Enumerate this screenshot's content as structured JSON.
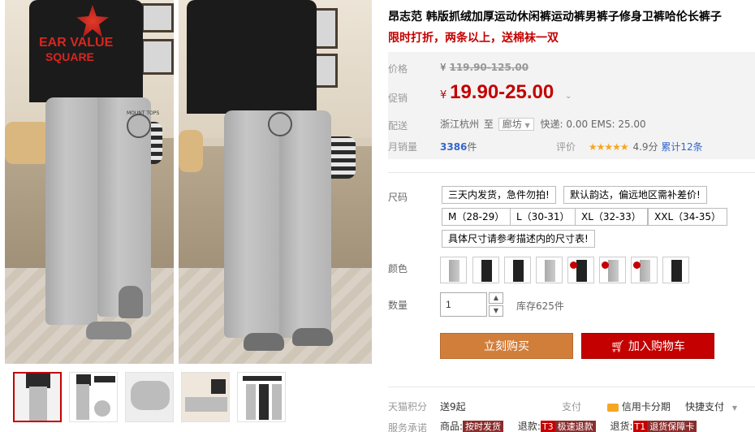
{
  "product": {
    "title": "昂志范 韩版抓绒加厚运动休闲裤运动裤男裤子修身卫裤哈伦长裤子",
    "promo": "限时打折，两条以上，送棉袜一双"
  },
  "main_photo": {
    "shirt_print_line1": "EAR VALUE",
    "shirt_print_line2": "SQUARE",
    "badge_text": "MOUNT TOPS"
  },
  "pricing": {
    "original_label": "价格",
    "currency": "¥",
    "original_price": "119.90-125.00",
    "promo_label": "促销",
    "promo_price": "19.90-25.00",
    "delivery_label": "配送",
    "origin": "浙江杭州",
    "to": "至",
    "destination": "廊坊",
    "shipping": "快递: 0.00 EMS: 25.00",
    "monthly_label": "月销量",
    "monthly_sales": "3386",
    "monthly_unit": "件",
    "rating_label": "评价",
    "stars": "★★★★★",
    "score": "4.9分",
    "reviews": "累计12条"
  },
  "sizes": {
    "label": "尺码",
    "notes": [
      "三天内发货，急件勿拍!",
      "默认韵达，偏远地区需补差价!"
    ],
    "options": [
      "M（28-29）",
      "L（30-31）",
      "XL（32-33）",
      "XXL（34-35）"
    ],
    "extra": "具体尺寸请参考描述内的尺寸表!"
  },
  "colors": {
    "label": "颜色",
    "swatches": [
      {
        "tone": "light",
        "tag": false
      },
      {
        "tone": "dark",
        "tag": false
      },
      {
        "tone": "dark",
        "tag": false
      },
      {
        "tone": "light",
        "tag": false
      },
      {
        "tone": "dark",
        "tag": true
      },
      {
        "tone": "light",
        "tag": true
      },
      {
        "tone": "light",
        "tag": true
      },
      {
        "tone": "dark",
        "tag": false
      }
    ]
  },
  "quantity": {
    "label": "数量",
    "value": "1",
    "stock": "库存625件",
    "up": "▲",
    "down": "▼"
  },
  "actions": {
    "buy_now": "立刻购买",
    "add_cart": "加入购物车"
  },
  "footer": {
    "points_label": "天猫积分",
    "points_value": "送9起",
    "pay_label": "支付",
    "credit": "信用卡分期",
    "quick_pay": "快捷支付",
    "service_label": "服务承诺",
    "goods_label": "商品:",
    "goods_chip": "按时发货",
    "return_label": "退款:",
    "return_code": "T3",
    "return_chip": "极速退款",
    "return2_label": "退货:",
    "return2_code": "T1",
    "return2_chip": "退货保障卡"
  },
  "colors_theme": {
    "accent_red": "#c40000",
    "buy_orange": "#d27e3b",
    "link_blue": "#3366cc",
    "star_gold": "#f5a623"
  }
}
